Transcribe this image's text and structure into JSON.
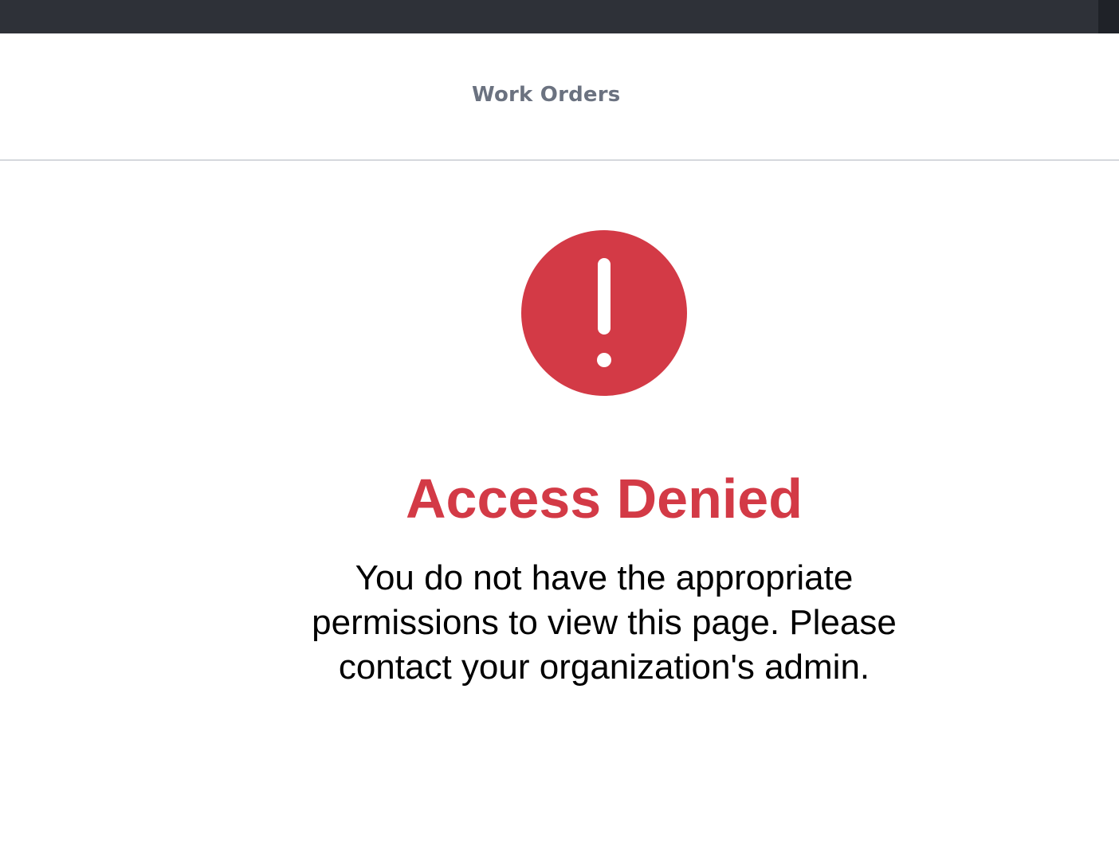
{
  "header": {
    "tab_label": "Work Orders"
  },
  "error": {
    "icon": "exclamation-circle-icon",
    "title": "Access Denied",
    "message": "You do not have the appropriate permissions to view this page. Please contact your organization's admin."
  },
  "colors": {
    "topbar": "#2e3138",
    "error_red": "#d33a46",
    "header_text": "#6b7280"
  }
}
